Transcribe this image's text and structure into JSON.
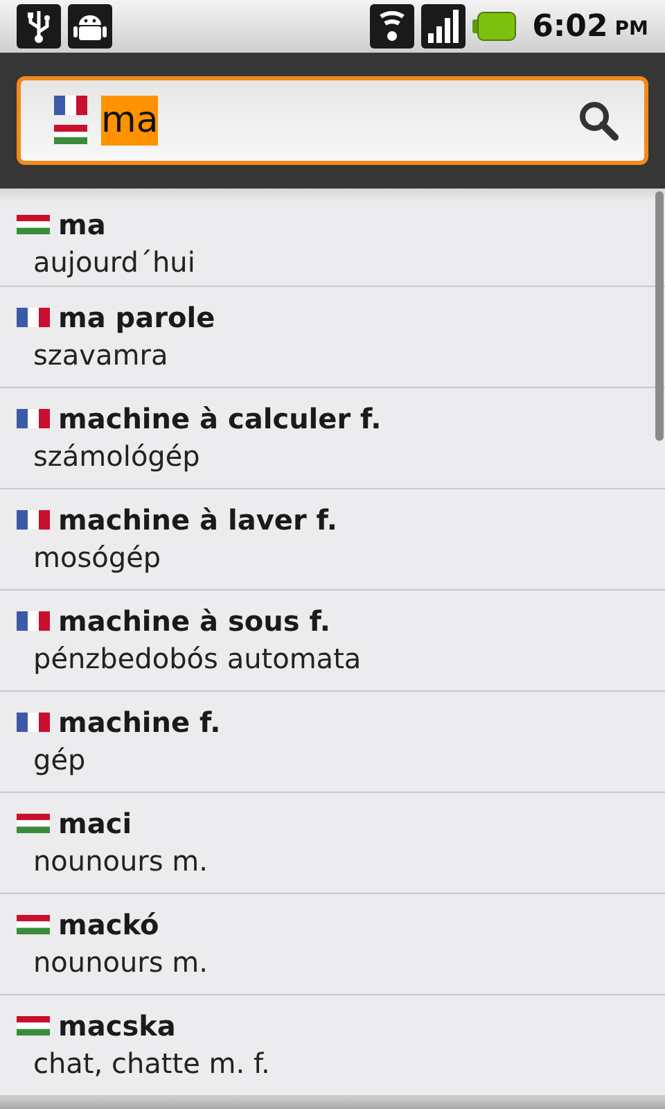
{
  "status_bar": {
    "time": "6:02",
    "ampm": "PM"
  },
  "search": {
    "value": "ma",
    "text_selected": true
  },
  "entries": [
    {
      "kind": "hu",
      "word": "ma",
      "translation": "aujourd´hui"
    },
    {
      "kind": "fr",
      "word": "ma parole",
      "translation": "szavamra"
    },
    {
      "kind": "fr",
      "word": "machine à calculer f.",
      "translation": "számológép"
    },
    {
      "kind": "fr",
      "word": "machine à laver f.",
      "translation": "mosógép"
    },
    {
      "kind": "fr",
      "word": "machine à sous f.",
      "translation": "pénzbedobós automata"
    },
    {
      "kind": "fr",
      "word": "machine f.",
      "translation": "gép"
    },
    {
      "kind": "hu",
      "word": "maci",
      "translation": "nounours m."
    },
    {
      "kind": "hu",
      "word": "mackó",
      "translation": "nounours m."
    },
    {
      "kind": "hu",
      "word": "macska",
      "translation": "chat, chatte m. f."
    }
  ]
}
